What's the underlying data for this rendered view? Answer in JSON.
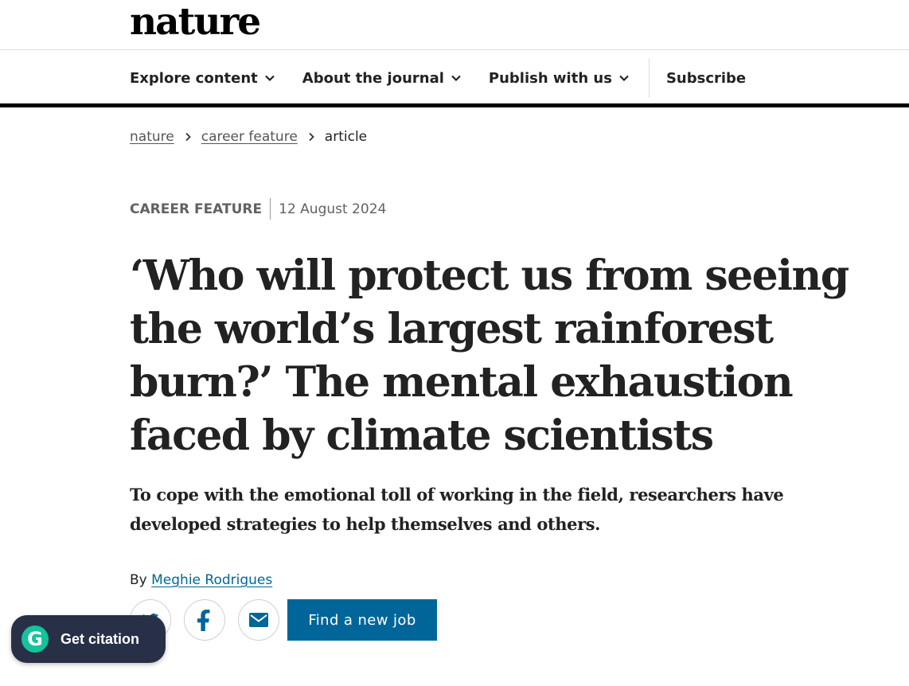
{
  "header": {
    "logo": "nature",
    "nav": [
      {
        "label": "Explore content"
      },
      {
        "label": "About the journal"
      },
      {
        "label": "Publish with us"
      }
    ],
    "subscribe": "Subscribe"
  },
  "breadcrumb": {
    "items": [
      "nature",
      "career feature"
    ],
    "current": "article"
  },
  "article": {
    "type": "CAREER FEATURE",
    "date": "12 August 2024",
    "title": "‘Who will protect us from seeing the world’s largest rainforest burn?’ The mental exhaustion faced by climate scientists",
    "standfirst": "To cope with the emotional toll of working in the field, researchers have developed strategies to help themselves and others.",
    "by_prefix": "By",
    "author": "Meghie Rodrigues"
  },
  "share": {
    "icons": [
      "twitter-icon",
      "facebook-icon",
      "email-icon"
    ],
    "job_button": "Find a new job"
  },
  "citation_widget": {
    "badge": "G",
    "label": "Get citation"
  },
  "colors": {
    "link_blue": "#006699",
    "job_button_bg": "#006699",
    "citation_bg": "#283048",
    "badge_green": "#15c39a"
  }
}
